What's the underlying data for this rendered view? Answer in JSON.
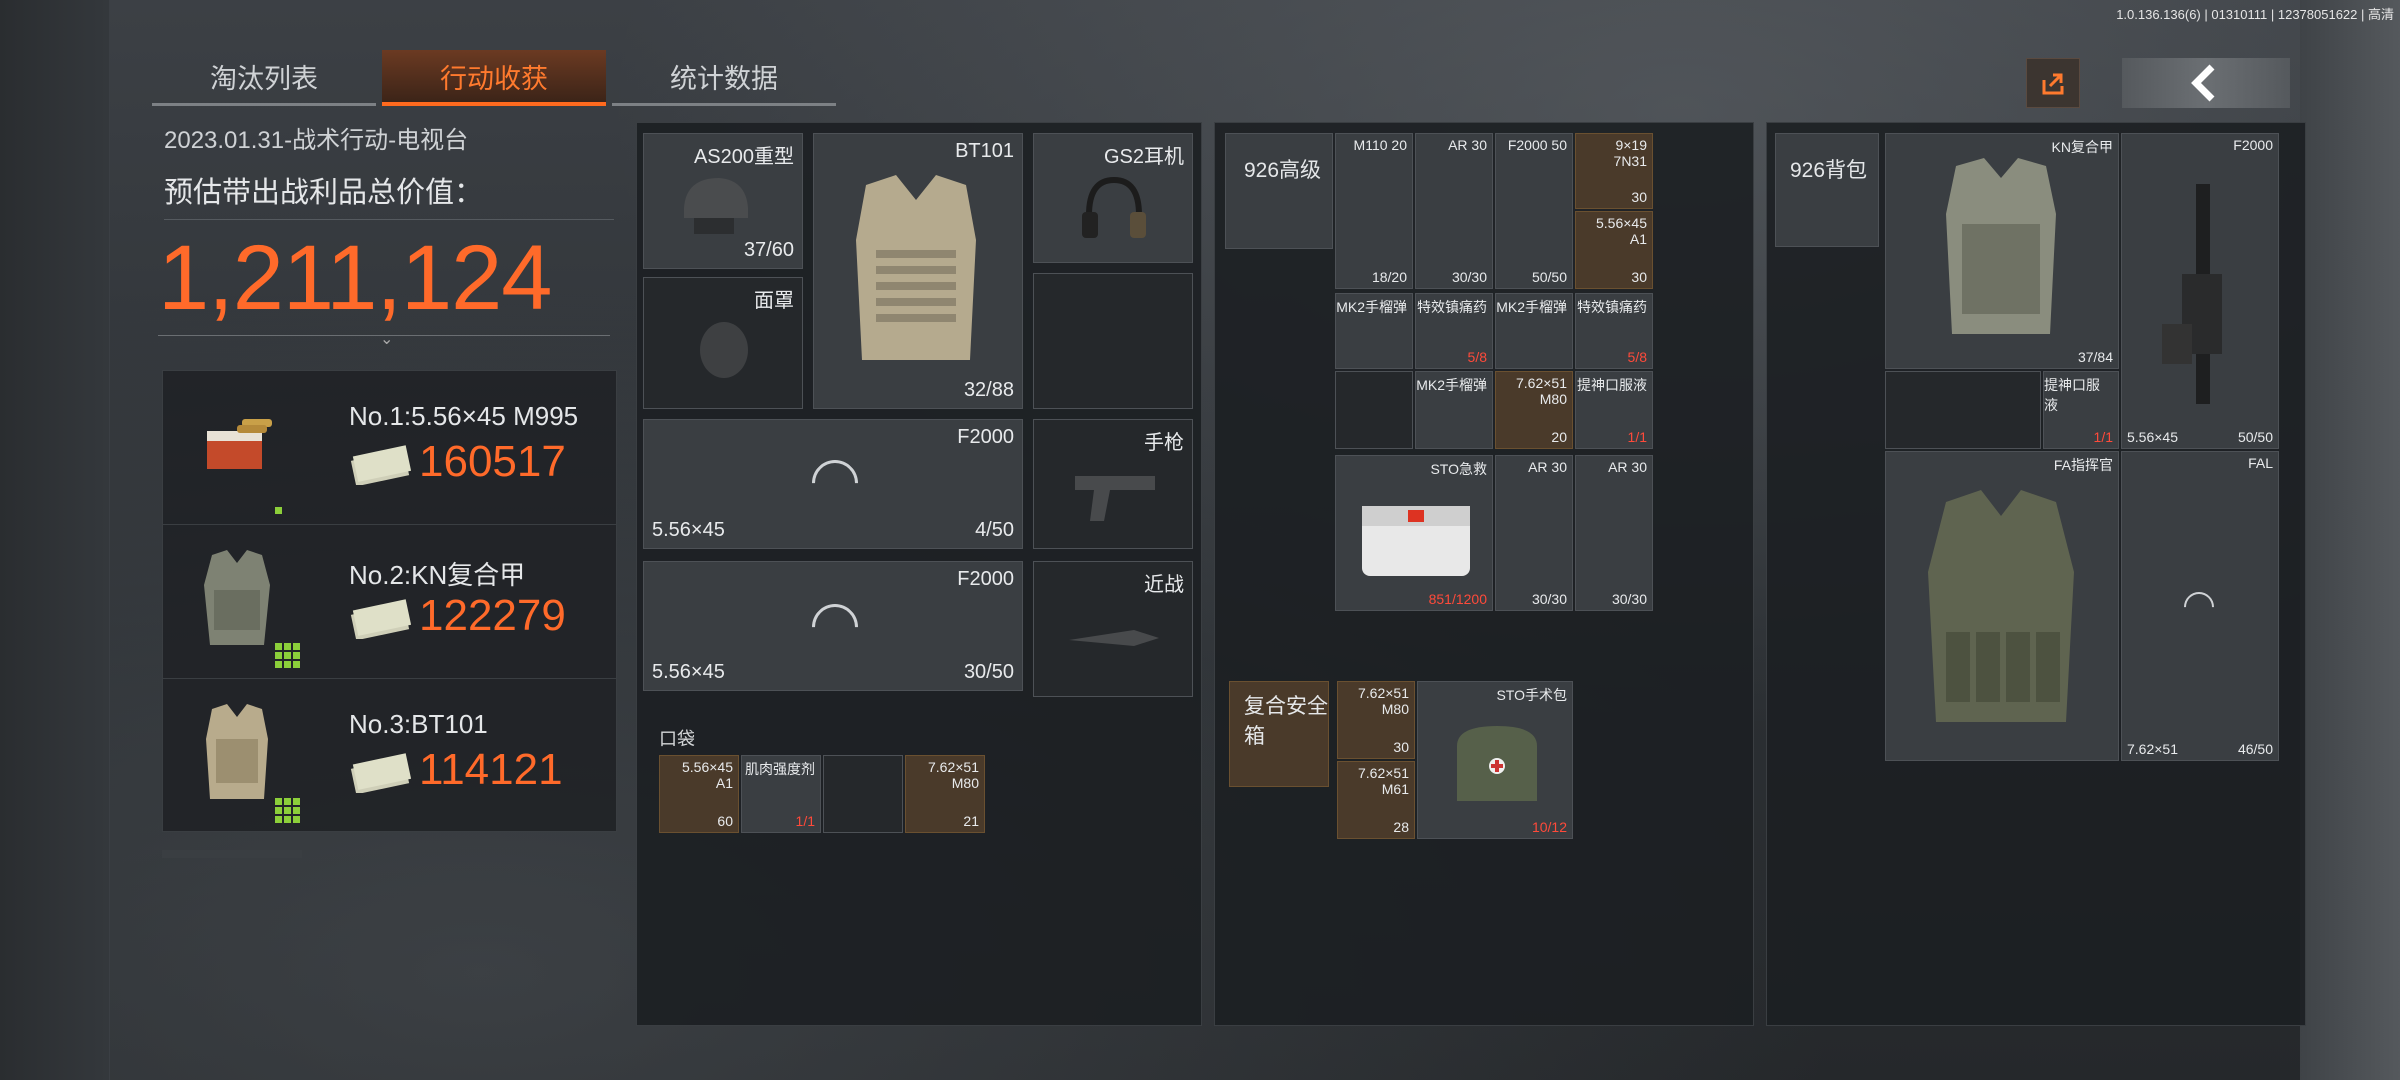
{
  "version": "1.0.136.136(6) | 01310111 | 12378051622 | 高清",
  "tabs": [
    {
      "label": "淘汰列表",
      "active": false
    },
    {
      "label": "行动收获",
      "active": true
    },
    {
      "label": "统计数据",
      "active": false
    }
  ],
  "summary": {
    "date_line": "2023.01.31-战术行动-电视台",
    "est_label": "预估带出战利品总价值：",
    "total_value": "1,211,124"
  },
  "ranking": [
    {
      "name": "No.1:5.56×45 M995",
      "price": "160517",
      "icon": "ammo-box-icon"
    },
    {
      "name": "No.2:KN复合甲",
      "price": "122279",
      "icon": "body-armor-icon"
    },
    {
      "name": "No.3:BT101",
      "price": "114121",
      "icon": "plate-carrier-icon"
    }
  ],
  "equipment": {
    "helmet": {
      "name": "AS200重型",
      "count": "37/60"
    },
    "armor": {
      "name": "BT101",
      "count": "32/88"
    },
    "headset": {
      "name": "GS2耳机"
    },
    "mask": {
      "name": "面罩"
    },
    "primary1": {
      "name": "F2000",
      "caliber": "5.56×45",
      "count": "4/50"
    },
    "primary2": {
      "name": "F2000",
      "caliber": "5.56×45",
      "count": "30/50"
    },
    "pistol": {
      "name": "手枪"
    },
    "melee": {
      "name": "近战"
    },
    "pocket_label": "口袋",
    "pocket": [
      {
        "name": "5.56×45\nA1",
        "count": "60",
        "style": "orange"
      },
      {
        "name": "肌肉强度剂",
        "count": "1/1",
        "style": "gray",
        "red": true
      },
      {
        "name": "",
        "count": "",
        "style": "dark"
      },
      {
        "name": "7.62×51\nM80",
        "count": "21",
        "style": "orange"
      }
    ]
  },
  "rig": {
    "title": "926高级",
    "items": [
      {
        "name": "M110 20",
        "count": "18/20"
      },
      {
        "name": "AR 30",
        "count": "30/30"
      },
      {
        "name": "F2000 50",
        "count": "50/50"
      },
      {
        "name": "9×19\n7N31",
        "count": "30"
      },
      {
        "name": "5.56×45\nA1",
        "count": "30"
      },
      {
        "name": "MK2手榴弹",
        "count": ""
      },
      {
        "name": "特效镇痛药",
        "count": "5/8"
      },
      {
        "name": "MK2手榴弹",
        "count": ""
      },
      {
        "name": "特效镇痛药",
        "count": "5/8"
      },
      {
        "name": "MK2手榴弹",
        "count": ""
      },
      {
        "name": "7.62×51\nM80",
        "count": "20"
      },
      {
        "name": "提神口服液",
        "count": "1/1"
      },
      {
        "name": "STO急救",
        "count": "851/1200"
      },
      {
        "name": "AR 30",
        "count": "30/30"
      },
      {
        "name": "AR 30",
        "count": "30/30"
      }
    ],
    "safe_box": {
      "title": "复合安全箱"
    },
    "safe_items": [
      {
        "name": "7.62×51\nM80",
        "count": "30"
      },
      {
        "name": "7.62×51\nM61",
        "count": "28"
      },
      {
        "name": "STO手术包",
        "count": "10/12"
      }
    ]
  },
  "backpack": {
    "title": "926背包",
    "items": [
      {
        "name": "KN复合甲",
        "count": "37/84"
      },
      {
        "name": "F2000",
        "caliber": "5.56×45",
        "count": "50/50"
      },
      {
        "name": "提神口服液",
        "count": "1/1"
      },
      {
        "name": "FA指挥官",
        "count": ""
      },
      {
        "name": "FAL",
        "caliber": "7.62×51",
        "count": "46/50"
      }
    ]
  }
}
